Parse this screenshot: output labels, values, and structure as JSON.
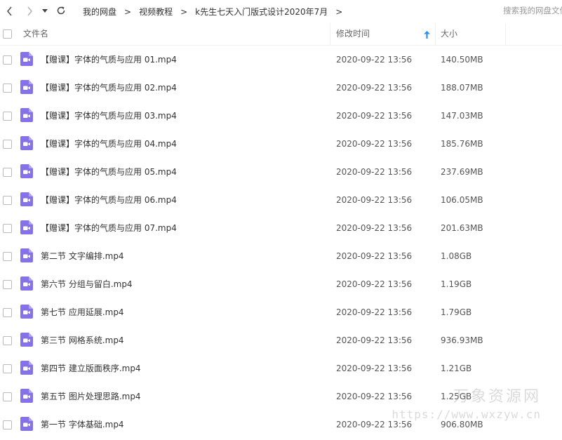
{
  "toolbar": {
    "back_icon": "chevron-left-icon",
    "forward_icon": "chevron-right-icon",
    "history_icon": "caret-down-icon",
    "refresh_icon": "refresh-icon",
    "breadcrumbs": [
      "我的网盘",
      "视频教程",
      "k先生七天入门版式设计2020年7月"
    ],
    "separator": ">",
    "search_placeholder": "搜索我的网盘文件"
  },
  "columns": {
    "name": "文件名",
    "modified": "修改时间",
    "size": "大小",
    "sort_icon": "sort-up-arrow-icon",
    "sort_color": "#2b8ff3"
  },
  "accent_color": "#8571e8",
  "files": [
    {
      "name": "【赠课】字体的气质与应用 01.mp4",
      "time": "2020-09-22 13:56",
      "size": "140.50MB"
    },
    {
      "name": "【赠课】字体的气质与应用 02.mp4",
      "time": "2020-09-22 13:56",
      "size": "188.07MB"
    },
    {
      "name": "【赠课】字体的气质与应用 03.mp4",
      "time": "2020-09-22 13:56",
      "size": "147.03MB"
    },
    {
      "name": "【赠课】字体的气质与应用 04.mp4",
      "time": "2020-09-22 13:56",
      "size": "185.76MB"
    },
    {
      "name": "【赠课】字体的气质与应用 05.mp4",
      "time": "2020-09-22 13:56",
      "size": "237.69MB"
    },
    {
      "name": "【赠课】字体的气质与应用 06.mp4",
      "time": "2020-09-22 13:56",
      "size": "106.05MB"
    },
    {
      "name": "【赠课】字体的气质与应用 07.mp4",
      "time": "2020-09-22 13:56",
      "size": "201.63MB"
    },
    {
      "name": "第二节 文字编排.mp4",
      "time": "2020-09-22 13:56",
      "size": "1.08GB"
    },
    {
      "name": "第六节 分组与留白.mp4",
      "time": "2020-09-22 13:56",
      "size": "1.19GB"
    },
    {
      "name": "第七节 应用延展.mp4",
      "time": "2020-09-22 13:56",
      "size": "1.79GB"
    },
    {
      "name": "第三节 网格系统.mp4",
      "time": "2020-09-22 13:56",
      "size": "936.93MB"
    },
    {
      "name": "第四节 建立版面秩序.mp4",
      "time": "2020-09-22 13:56",
      "size": "1.21GB"
    },
    {
      "name": "第五节 图片处理思路.mp4",
      "time": "2020-09-22 13:56",
      "size": "1.25GB"
    },
    {
      "name": "第一节 字体基础.mp4",
      "time": "2020-09-22 13:56",
      "size": "906.80MB"
    }
  ],
  "watermark": {
    "text": "万象资源网",
    "url": "https://www.wxzyw.cn"
  }
}
